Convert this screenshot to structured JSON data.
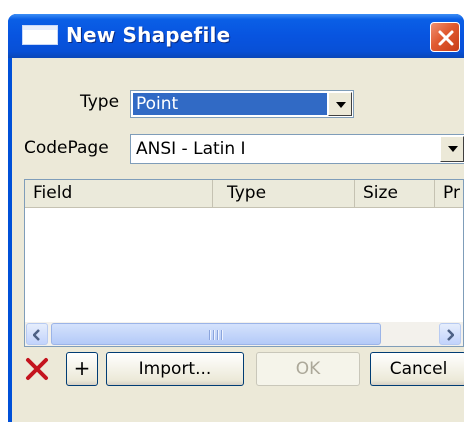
{
  "window": {
    "title": "New Shapefile"
  },
  "type_field": {
    "label": "Type",
    "value": "Point"
  },
  "codepage_field": {
    "label": "CodePage",
    "value": "ANSI - Latin I"
  },
  "fields_table": {
    "columns": [
      "Field",
      "Type",
      "Size",
      "Pr"
    ],
    "rows": []
  },
  "buttons": {
    "add": "+",
    "import": "Import...",
    "ok": "OK",
    "cancel": "Cancel"
  },
  "icons": {
    "title": "window-icon",
    "close": "close-icon",
    "delete": "delete-x-icon",
    "dropdown": "chevron-down-icon",
    "scroll_left": "arrow-left-icon",
    "scroll_right": "arrow-right-icon"
  },
  "colors": {
    "titlebar": "#0854e0",
    "selection": "#316ac5",
    "delete_icon": "#c4141e",
    "face": "#ece9d8"
  }
}
